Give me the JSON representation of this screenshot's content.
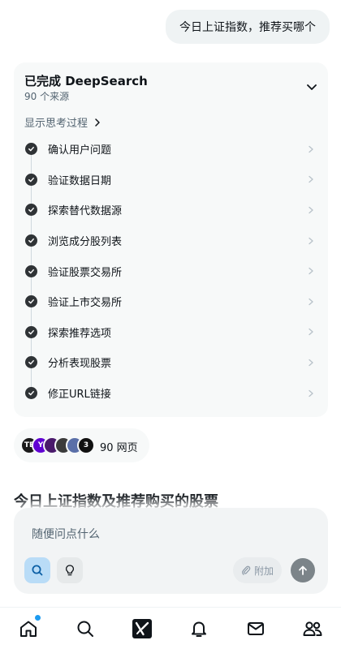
{
  "user_message": "今日上证指数，推荐买哪个",
  "deepsearch": {
    "title": "已完成 DeepSearch",
    "sources": "90 个来源",
    "show_thinking": "显示思考过程",
    "steps": [
      {
        "label": "确认用户问题"
      },
      {
        "label": "验证数据日期"
      },
      {
        "label": "探索替代数据源"
      },
      {
        "label": "浏览成分股列表"
      },
      {
        "label": "验证股票交易所"
      },
      {
        "label": "验证上市交易所"
      },
      {
        "label": "探索推荐选项"
      },
      {
        "label": "分析表现股票"
      },
      {
        "label": "修正URL链接"
      }
    ]
  },
  "sources_pill": {
    "label": "90 网页",
    "favicons": [
      {
        "text": "TE",
        "color": "#1a1a1a"
      },
      {
        "text": "Y",
        "color": "#6001d2"
      },
      {
        "text": "",
        "color": "#4a1a6b"
      },
      {
        "text": "",
        "color": "#3b3b3b"
      },
      {
        "text": "",
        "color": "#5a6fa8"
      },
      {
        "text": "3",
        "color": "#111111"
      }
    ]
  },
  "answer": {
    "heading": "今日上证指数及推荐购买的股票"
  },
  "composer": {
    "placeholder": "随便问点什么",
    "attach_label": "附加",
    "search_icon": "search-icon",
    "think_icon": "lightbulb-icon",
    "send_icon": "arrow-up-icon",
    "active_color": "#b9dcf7"
  },
  "tabbar": {
    "items": [
      {
        "name": "home",
        "icon": "home-icon",
        "active": true,
        "notification": true
      },
      {
        "name": "search",
        "icon": "search-icon"
      },
      {
        "name": "grok",
        "icon": "grok-icon"
      },
      {
        "name": "notifications",
        "icon": "bell-icon"
      },
      {
        "name": "messages",
        "icon": "mail-icon"
      },
      {
        "name": "communities",
        "icon": "people-icon"
      }
    ],
    "accent": "#1d9bf0"
  }
}
